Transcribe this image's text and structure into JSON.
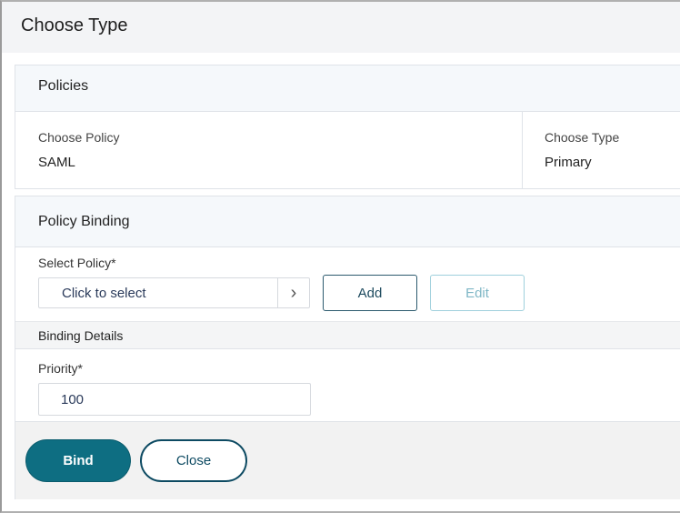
{
  "title": "Choose Type",
  "policies": {
    "heading": "Policies",
    "choose_policy_label": "Choose Policy",
    "choose_policy_value": "SAML",
    "choose_type_label": "Choose Type",
    "choose_type_value": "Primary"
  },
  "binding": {
    "heading": "Policy Binding",
    "select_policy_label": "Select Policy*",
    "select_policy_placeholder": "Click to select",
    "add_label": "Add",
    "edit_label": "Edit",
    "details_heading": "Binding Details",
    "priority_label": "Priority*",
    "priority_value": "100"
  },
  "footer": {
    "bind_label": "Bind",
    "close_label": "Close"
  },
  "colors": {
    "primary": "#0e6e82"
  }
}
